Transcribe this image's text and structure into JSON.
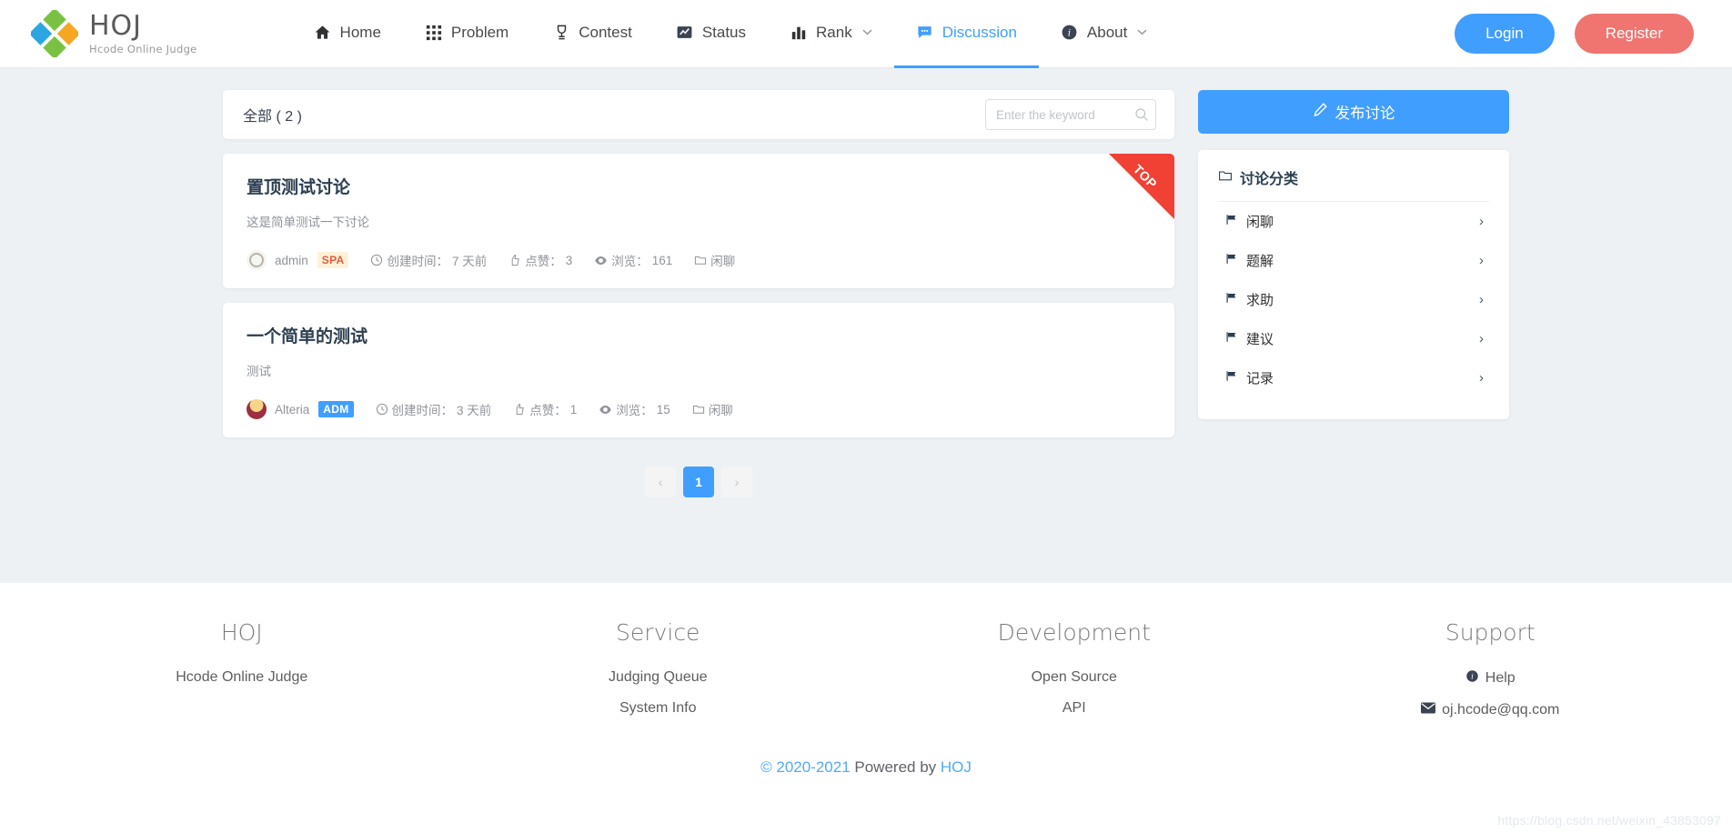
{
  "header": {
    "brand": {
      "title": "HOJ",
      "subtitle": "Hcode Online Judge",
      "logo_icon": "hoj-pinwheel-logo"
    },
    "nav": [
      {
        "label": "Home",
        "icon": "home-icon",
        "active": false,
        "caret": ""
      },
      {
        "label": "Problem",
        "icon": "grid-icon",
        "active": false,
        "caret": ""
      },
      {
        "label": "Contest",
        "icon": "trophy-icon",
        "active": false,
        "caret": ""
      },
      {
        "label": "Status",
        "icon": "chart-line-icon",
        "active": false,
        "caret": ""
      },
      {
        "label": "Rank",
        "icon": "bar-chart-icon",
        "active": false,
        "caret": "⌄"
      },
      {
        "label": "Discussion",
        "icon": "comment-icon",
        "active": true,
        "caret": ""
      },
      {
        "label": "About",
        "icon": "info-circle-icon",
        "active": false,
        "caret": "⌄"
      }
    ],
    "login_label": "Login",
    "register_label": "Register",
    "accent_blue": "#409eff",
    "register_red": "#f07470"
  },
  "main": {
    "filter": {
      "label": "全部 ( 2 )",
      "search_placeholder": "Enter the keyword",
      "search_value": ""
    },
    "discussions": [
      {
        "title": "置顶测试讨论",
        "description": "这是简单测试一下讨论",
        "author": "admin",
        "badge": "SPA",
        "badge_type": "spa",
        "avatar": "admin-avatar",
        "created_label": "创建时间：",
        "created_value": "7 天前",
        "like_label": "点赞：",
        "like_value": "3",
        "view_label": "浏览：",
        "view_value": "161",
        "category": "闲聊",
        "top_ribbon": "TOP",
        "pinned": true
      },
      {
        "title": "一个简单的测试",
        "description": "测试",
        "author": "Alteria",
        "badge": "ADM",
        "badge_type": "adm",
        "avatar": "alteria-avatar",
        "created_label": "创建时间：",
        "created_value": "3 天前",
        "like_label": "点赞：",
        "like_value": "1",
        "view_label": "浏览：",
        "view_value": "15",
        "category": "闲聊",
        "top_ribbon": "",
        "pinned": false
      }
    ],
    "pagination": {
      "prev": "‹",
      "pages": [
        "1"
      ],
      "current": "1",
      "next": "›"
    }
  },
  "sidebar": {
    "publish_label": "发布讨论",
    "publish_icon": "pencil-icon",
    "category_title": "讨论分类",
    "category_icon": "folder-icon",
    "categories": [
      {
        "label": "闲聊",
        "icon": "flag-icon",
        "chevron": "›"
      },
      {
        "label": "题解",
        "icon": "flag-icon",
        "chevron": "›"
      },
      {
        "label": "求助",
        "icon": "flag-icon",
        "chevron": "›"
      },
      {
        "label": "建议",
        "icon": "flag-icon",
        "chevron": "›"
      },
      {
        "label": "记录",
        "icon": "flag-icon",
        "chevron": "›"
      }
    ]
  },
  "footer": {
    "columns": [
      {
        "title": "HOJ",
        "links": [
          {
            "label": "Hcode Online Judge",
            "icon": ""
          }
        ]
      },
      {
        "title": "Service",
        "links": [
          {
            "label": "Judging Queue",
            "icon": ""
          },
          {
            "label": "System Info",
            "icon": ""
          }
        ]
      },
      {
        "title": "Development",
        "links": [
          {
            "label": "Open Source",
            "icon": ""
          },
          {
            "label": "API",
            "icon": ""
          }
        ]
      },
      {
        "title": "Support",
        "links": [
          {
            "label": "Help",
            "icon": "info-circle-icon"
          },
          {
            "label": "oj.hcode@qq.com",
            "icon": "envelope-icon"
          }
        ]
      }
    ],
    "copyright_year": "© 2020-2021",
    "copyright_mid": " Powered by ",
    "copyright_brand": "HOJ",
    "watermark": "https://blog.csdn.net/weixin_43853097"
  }
}
